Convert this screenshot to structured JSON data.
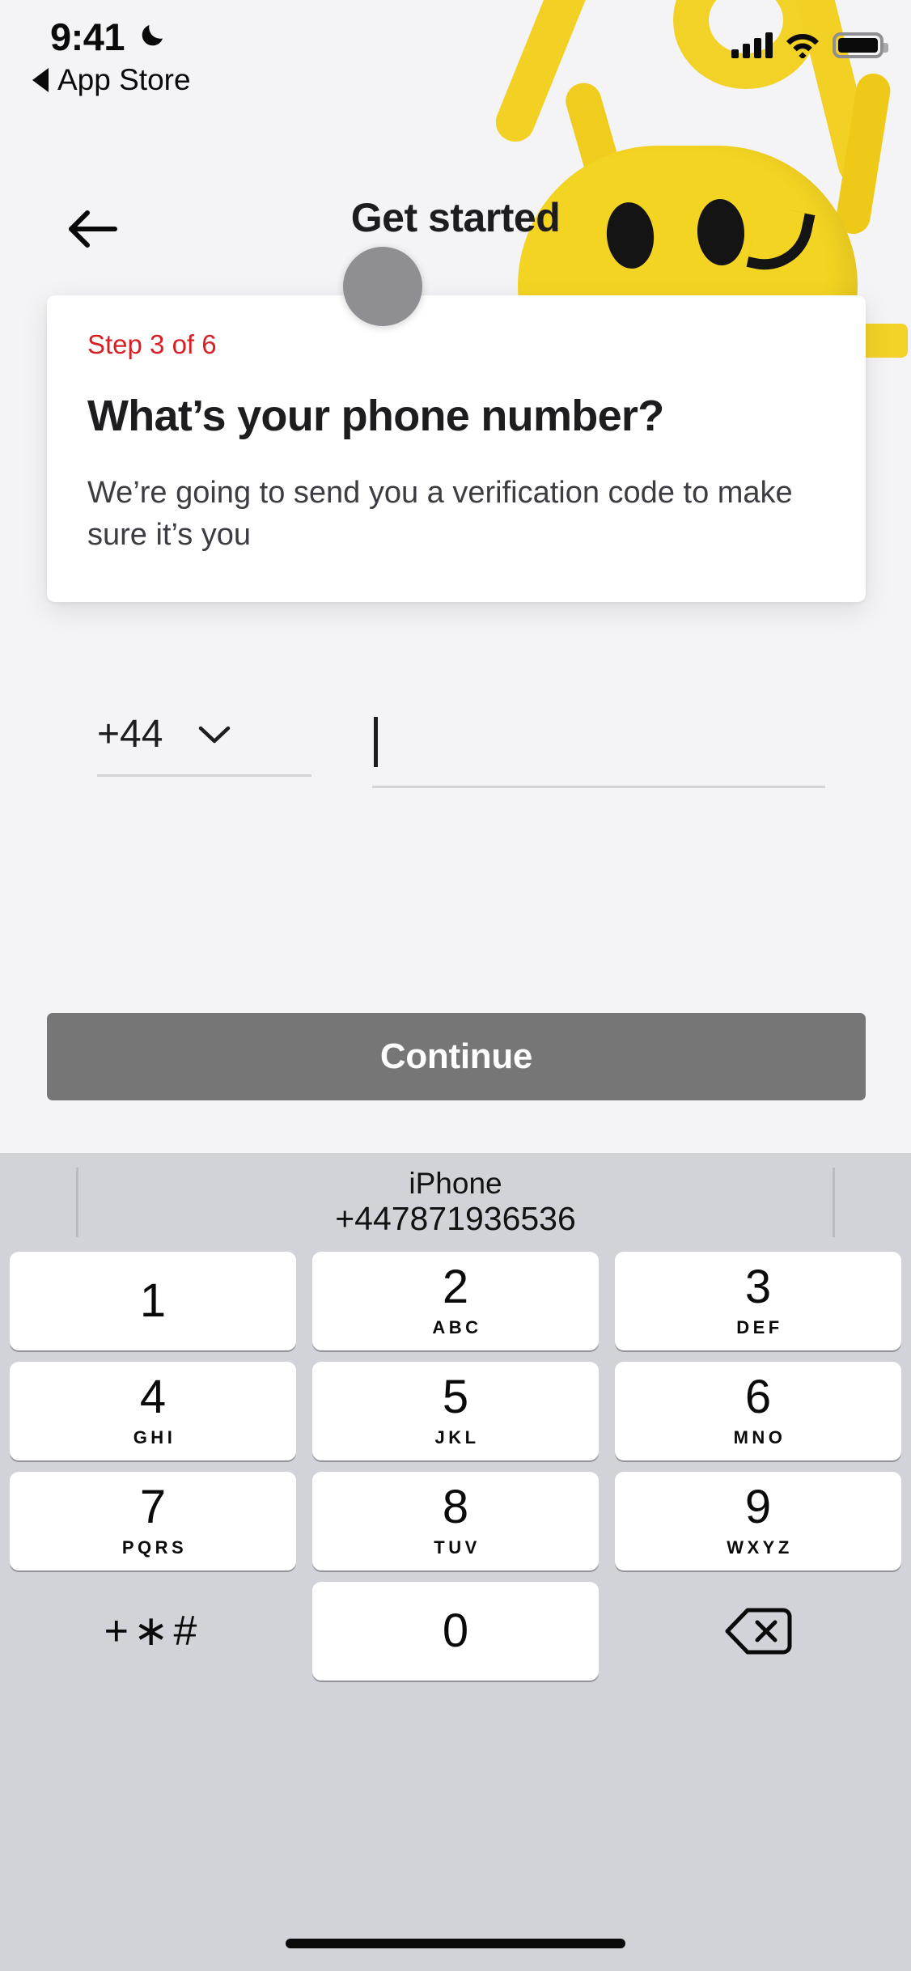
{
  "status_bar": {
    "time": "9:41",
    "dnd_icon": "moon-icon",
    "signal_icon": "cellular-signal-icon",
    "wifi_icon": "wifi-icon",
    "battery_icon": "battery-full-icon"
  },
  "back_to_app": {
    "label": "App Store",
    "icon": "back-triangle-icon"
  },
  "nav": {
    "back_icon": "arrow-left-icon",
    "title": "Get started"
  },
  "card": {
    "step": "Step 3 of 6",
    "title": "What’s your phone number?",
    "body": "We’re going to send you a verification code to make sure it’s you",
    "step_color": "#d81f26"
  },
  "phone_input": {
    "country_code": "+44",
    "chevron_icon": "chevron-down-icon",
    "number_value": "",
    "number_placeholder": ""
  },
  "primary_button": {
    "label": "Continue",
    "color": "#767676",
    "text_color": "#ffffff"
  },
  "keyboard": {
    "suggestion": {
      "label": "iPhone",
      "value": "+447871936536"
    },
    "rows": [
      [
        {
          "digit": "1",
          "letters": ""
        },
        {
          "digit": "2",
          "letters": "ABC"
        },
        {
          "digit": "3",
          "letters": "DEF"
        }
      ],
      [
        {
          "digit": "4",
          "letters": "GHI"
        },
        {
          "digit": "5",
          "letters": "JKL"
        },
        {
          "digit": "6",
          "letters": "MNO"
        }
      ],
      [
        {
          "digit": "7",
          "letters": "PQRS"
        },
        {
          "digit": "8",
          "letters": "TUV"
        },
        {
          "digit": "9",
          "letters": "WXYZ"
        }
      ]
    ],
    "symbols_key": "+∗#",
    "zero_key": "0",
    "delete_icon": "delete-backward-icon"
  }
}
